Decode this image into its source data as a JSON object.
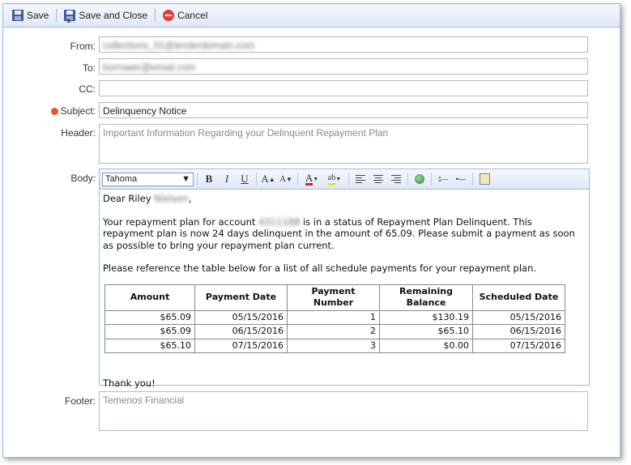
{
  "toolbar": {
    "save_label": "Save",
    "save_close_label": "Save and Close",
    "cancel_label": "Cancel"
  },
  "form": {
    "from_label": "From:",
    "from_value": "collections_01@lenderdomain.com",
    "to_label": "To:",
    "to_value": "borrower@email.com",
    "cc_label": "CC:",
    "cc_value": "",
    "subject_label": "Subject:",
    "subject_value": "Delinquency Notice",
    "header_label": "Header:",
    "header_placeholder": "Important Information Regarding your Delinquent Repayment Plan",
    "body_label": "Body:",
    "footer_label": "Footer:",
    "footer_placeholder": "Temenos Financial"
  },
  "editor": {
    "font": "Tahoma",
    "toolbar_icons": [
      "bold-icon",
      "italic-icon",
      "underline-icon",
      "grow-font-icon",
      "shrink-font-icon",
      "font-color-icon",
      "highlight-icon",
      "align-left-icon",
      "align-center-icon",
      "align-right-icon",
      "insert-link-icon",
      "numbered-list-icon",
      "bullet-list-icon",
      "source-edit-icon"
    ],
    "greeting": "Dear Riley",
    "greeting_lastname": "Nielsen",
    "greeting_suffix": ",",
    "para1_a": "Your repayment plan for account",
    "account_masked": "4311188",
    "para1_b": "is in a status of Repayment Plan Delinquent. This repayment plan is now 24 days delinquent in the amount of 65.09. Please submit a payment as soon as possible to bring your repayment plan current.",
    "para2": "Please reference the table below for a list of all schedule payments for your repayment plan.",
    "table": {
      "headers": [
        "Amount",
        "Payment Date",
        "Payment Number",
        "Remaining Balance",
        "Scheduled Date"
      ],
      "rows": [
        [
          "$65.09",
          "05/15/2016",
          "1",
          "$130.19",
          "05/15/2016"
        ],
        [
          "$65.09",
          "06/15/2016",
          "2",
          "$65.10",
          "06/15/2016"
        ],
        [
          "$65.10",
          "07/15/2016",
          "3",
          "$0.00",
          "07/15/2016"
        ]
      ]
    },
    "closing": "Thank you!"
  },
  "colors": {
    "accent_border": "#99bbe8",
    "required_dot": "#e5532b",
    "cancel_icon": "#e23c3c"
  }
}
